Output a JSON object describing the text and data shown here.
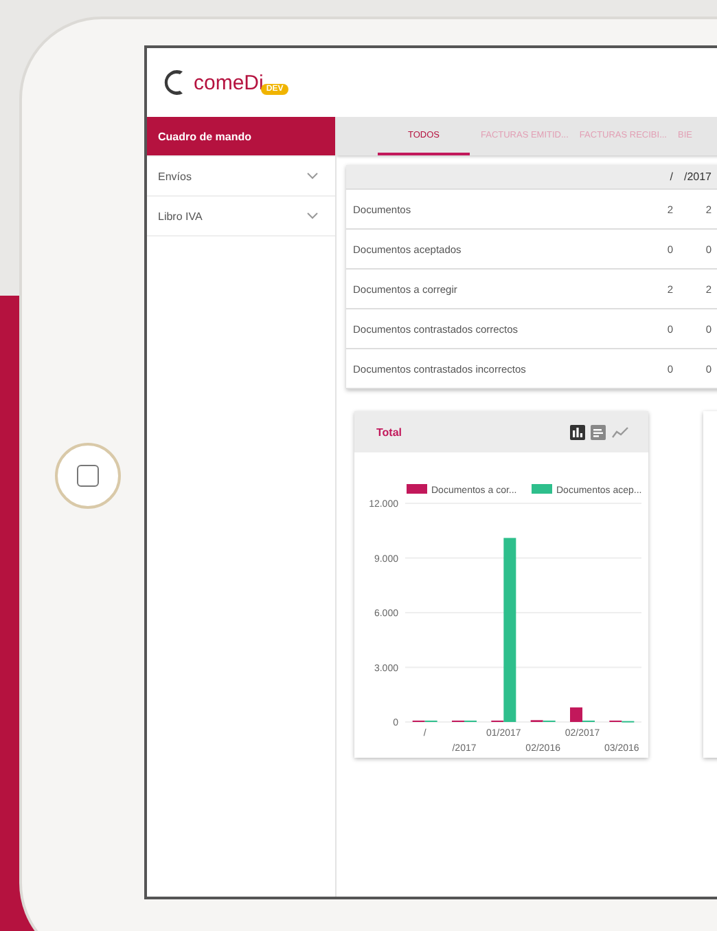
{
  "logo": {
    "text": "comeDi",
    "badge": "DEV"
  },
  "sidebar": {
    "items": [
      {
        "label": "Cuadro de mando",
        "selected": true,
        "expandable": false
      },
      {
        "label": "Envíos",
        "selected": false,
        "expandable": true
      },
      {
        "label": "Libro IVA",
        "selected": false,
        "expandable": true
      }
    ]
  },
  "tabs": [
    {
      "label": "TODOS",
      "selected": true
    },
    {
      "label": "FACTURAS EMITID...",
      "selected": false
    },
    {
      "label": "FACTURAS RECIBI...",
      "selected": false
    },
    {
      "label": "BIE",
      "selected": false
    }
  ],
  "table": {
    "columns": [
      "/",
      "/2017"
    ],
    "rows": [
      {
        "label": "Documentos",
        "values": [
          "2",
          "2"
        ]
      },
      {
        "label": "Documentos aceptados",
        "values": [
          "0",
          "0"
        ]
      },
      {
        "label": "Documentos a corregir",
        "values": [
          "2",
          "2"
        ]
      },
      {
        "label": "Documentos contrastados correctos",
        "values": [
          "0",
          "0"
        ]
      },
      {
        "label": "Documentos contrastados incorrectos",
        "values": [
          "0",
          "0"
        ]
      }
    ]
  },
  "chart_card": {
    "title": "Total",
    "view_options": [
      {
        "kind": "bar",
        "selected": true
      },
      {
        "kind": "list",
        "selected": false
      },
      {
        "kind": "line",
        "selected": false
      }
    ],
    "chart_data": {
      "type": "bar",
      "categories": [
        "/",
        "/2017",
        "01/2017",
        "02/2016",
        "02/2017",
        "03/2016"
      ],
      "series": [
        {
          "name": "Documentos a cor...",
          "color": "#c2185b",
          "values": [
            0,
            0,
            0,
            100,
            800,
            0
          ]
        },
        {
          "name": "Documentos acep...",
          "color": "#2ebf8c",
          "values": [
            0,
            0,
            10100,
            0,
            0,
            50
          ]
        }
      ],
      "grid": true,
      "legend": "top",
      "ylim": [
        0,
        12000
      ],
      "yticks": [
        {
          "value": 0,
          "label": "0"
        },
        {
          "value": 3000,
          "label": "3.000"
        },
        {
          "value": 6000,
          "label": "6.000"
        },
        {
          "value": 9000,
          "label": "9.000"
        },
        {
          "value": 12000,
          "label": "12.000"
        }
      ]
    }
  }
}
